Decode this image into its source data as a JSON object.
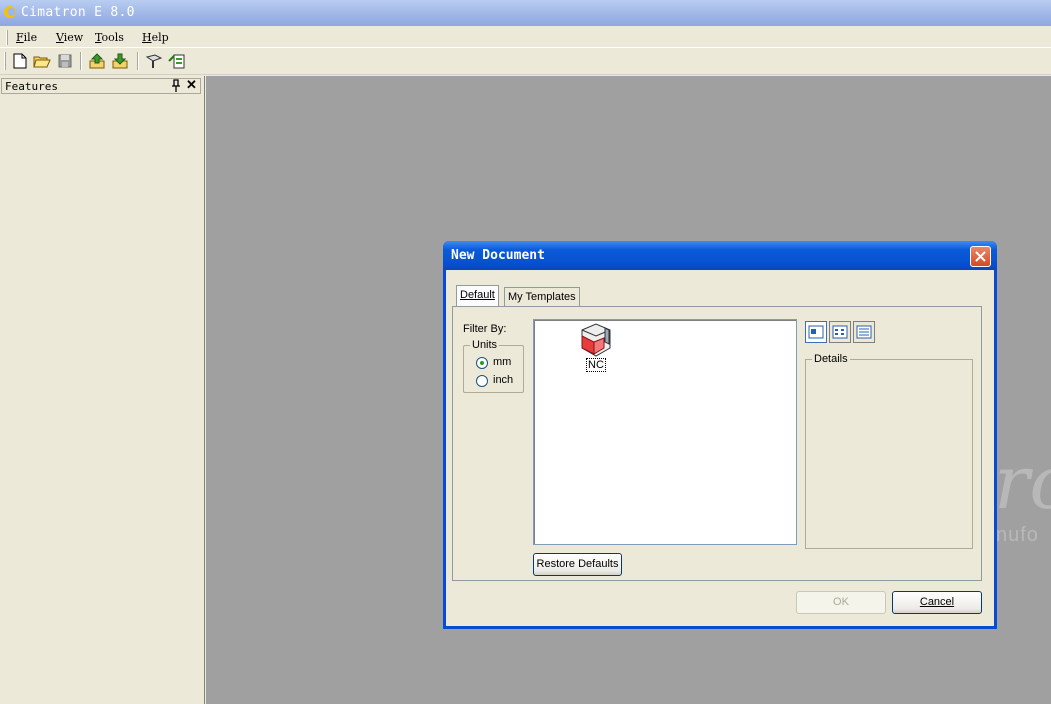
{
  "app": {
    "title": "Cimatron E 8.0"
  },
  "menu": [
    {
      "u": "F",
      "rest": "ile"
    },
    {
      "u": "V",
      "rest": "iew"
    },
    {
      "u": "T",
      "rest": "ools"
    },
    {
      "u": "H",
      "rest": "elp"
    }
  ],
  "toolbar": {
    "buttons": [
      "new-document-icon",
      "open-folder-icon",
      "save-icon",
      "import-icon",
      "export-icon",
      "nc-wizard-icon",
      "nc-setup-icon"
    ]
  },
  "features_panel": {
    "title": "Features",
    "close": "✕"
  },
  "workspace": {
    "watermark_large": "ro",
    "watermark_small": "nufo"
  },
  "dialog": {
    "title": "New Document",
    "tabs": [
      "Default",
      "My Templates"
    ],
    "filter_label": "Filter By:",
    "units_label": "Units",
    "units": [
      {
        "label": "mm",
        "checked": true
      },
      {
        "label": "inch",
        "checked": false
      }
    ],
    "templates": [
      {
        "label": "NC",
        "icon": "nc-document-icon"
      }
    ],
    "details_label": "Details",
    "restore_defaults": "Restore Defaults",
    "ok": "OK",
    "cancel": "Cancel"
  }
}
